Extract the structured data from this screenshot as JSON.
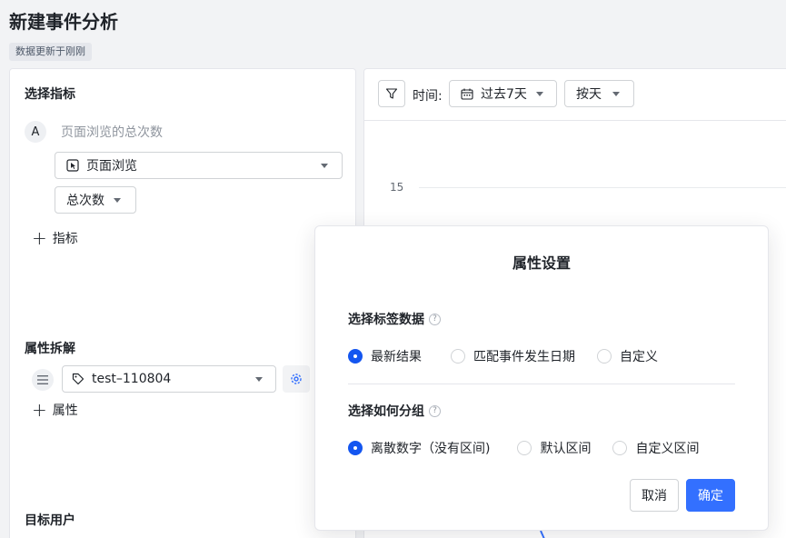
{
  "page": {
    "title": "新建事件分析",
    "update_status": "数据更新于刚刚"
  },
  "left": {
    "metrics_title": "选择指标",
    "metric": {
      "badge": "A",
      "name": "页面浏览的总次数",
      "event_select": "页面浏览",
      "agg_select": "总次数"
    },
    "add_metric": "指标",
    "breakdown_title": "属性拆解",
    "breakdown_select": "test–110804",
    "add_property": "属性",
    "target_title": "目标用户"
  },
  "toolbar": {
    "time_label": "时间:",
    "range_select": "过去7天",
    "granularity_select": "按天"
  },
  "chart": {
    "y_tick": "15"
  },
  "modal": {
    "title": "属性设置",
    "section1_title": "选择标签数据",
    "section1_options": [
      "最新结果",
      "匹配事件发生日期",
      "自定义"
    ],
    "section1_selected": 0,
    "section2_title": "选择如何分组",
    "section2_options": [
      "离散数字（没有区间)",
      "默认区间",
      "自定义区间"
    ],
    "section2_selected": 0,
    "cancel_label": "取消",
    "ok_label": "确定",
    "help_glyph": "?"
  },
  "icons": {
    "event": "page-view-icon",
    "tag": "tag-icon",
    "settings": "gear-icon",
    "filter": "filter-icon",
    "calendar": "calendar-icon",
    "drag": "drag-handle-icon"
  },
  "colors": {
    "primary": "#3370ff",
    "radio_checked": "#1456f0",
    "text": "#1f2329",
    "muted": "#8f959e"
  }
}
